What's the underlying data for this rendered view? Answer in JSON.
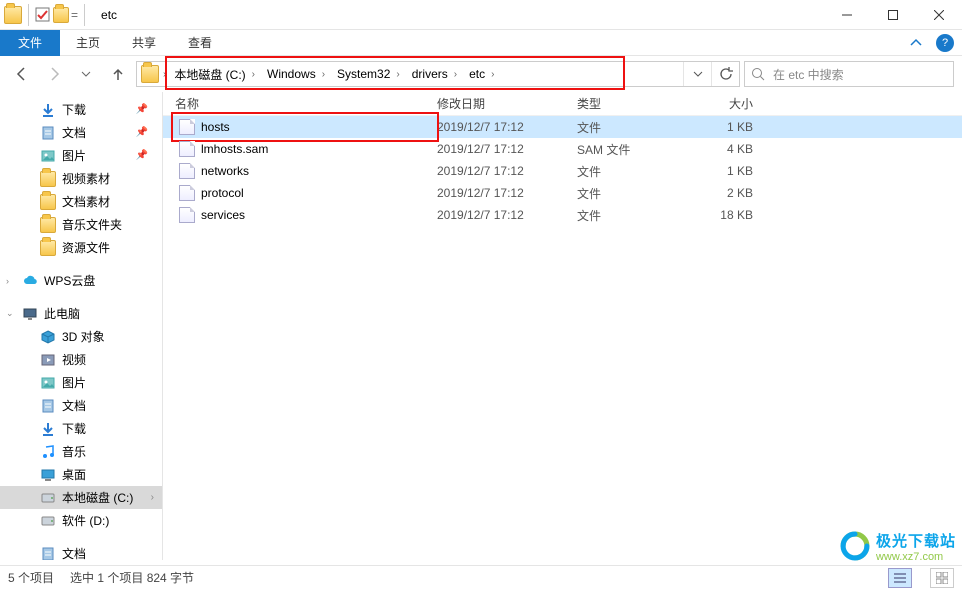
{
  "window": {
    "title": "etc"
  },
  "ribbon": {
    "file": "文件",
    "home": "主页",
    "share": "共享",
    "view": "查看"
  },
  "breadcrumbs": [
    "本地磁盘 (C:)",
    "Windows",
    "System32",
    "drivers",
    "etc"
  ],
  "search": {
    "placeholder": "在 etc 中搜索"
  },
  "columns": {
    "name": "名称",
    "date": "修改日期",
    "type": "类型",
    "size": "大小"
  },
  "files": [
    {
      "name": "hosts",
      "date": "2019/12/7 17:12",
      "type": "文件",
      "size": "1 KB",
      "selected": true
    },
    {
      "name": "lmhosts.sam",
      "date": "2019/12/7 17:12",
      "type": "SAM 文件",
      "size": "4 KB",
      "selected": false
    },
    {
      "name": "networks",
      "date": "2019/12/7 17:12",
      "type": "文件",
      "size": "1 KB",
      "selected": false
    },
    {
      "name": "protocol",
      "date": "2019/12/7 17:12",
      "type": "文件",
      "size": "2 KB",
      "selected": false
    },
    {
      "name": "services",
      "date": "2019/12/7 17:12",
      "type": "文件",
      "size": "18 KB",
      "selected": false
    }
  ],
  "nav": {
    "quick": [
      {
        "label": "下载",
        "icon": "download",
        "pinned": true
      },
      {
        "label": "文档",
        "icon": "document",
        "pinned": true
      },
      {
        "label": "图片",
        "icon": "picture",
        "pinned": true
      },
      {
        "label": "视频素材",
        "icon": "folder",
        "pinned": false
      },
      {
        "label": "文档素材",
        "icon": "folder",
        "pinned": false
      },
      {
        "label": "音乐文件夹",
        "icon": "folder",
        "pinned": false
      },
      {
        "label": "资源文件",
        "icon": "folder",
        "pinned": false
      }
    ],
    "wps": "WPS云盘",
    "thispc": "此电脑",
    "pc_items": [
      {
        "label": "3D 对象",
        "icon": "3d"
      },
      {
        "label": "视频",
        "icon": "video"
      },
      {
        "label": "图片",
        "icon": "picture"
      },
      {
        "label": "文档",
        "icon": "document"
      },
      {
        "label": "下载",
        "icon": "download"
      },
      {
        "label": "音乐",
        "icon": "music"
      },
      {
        "label": "桌面",
        "icon": "desktop"
      },
      {
        "label": "本地磁盘 (C:)",
        "icon": "disk",
        "selected": true
      },
      {
        "label": "软件 (D:)",
        "icon": "disk"
      }
    ],
    "last": "文档"
  },
  "status": {
    "count": "5 个项目",
    "selection": "选中 1 个项目   824 字节"
  },
  "watermark": {
    "line1": "极光下载站",
    "line2": "www.xz7.com"
  }
}
